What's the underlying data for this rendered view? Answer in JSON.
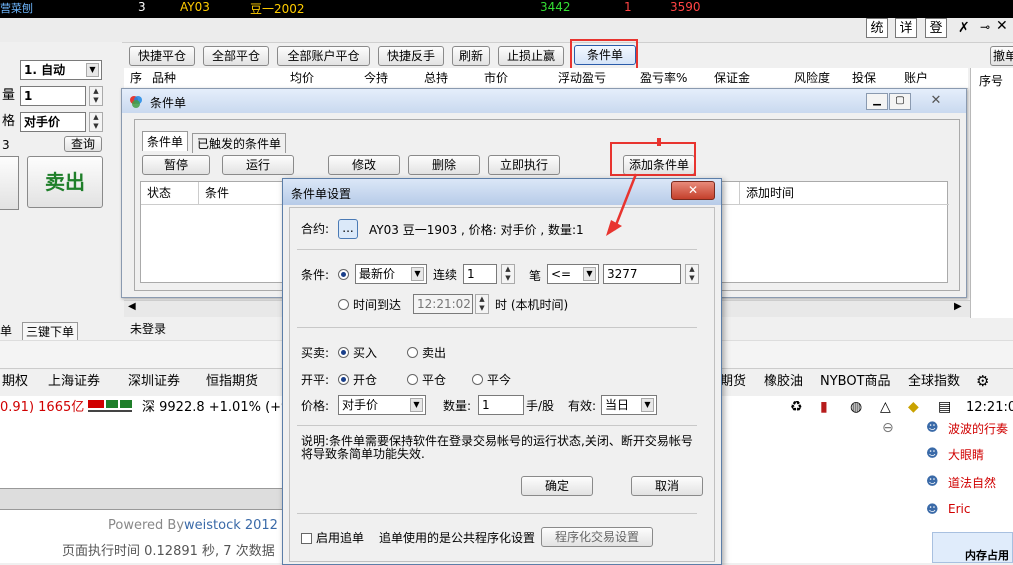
{
  "top": {
    "row_num": "3",
    "row_code": "AY03",
    "row_name": "豆一2002",
    "row_v1": "3442",
    "row_v2": "1",
    "row_v3": "3590",
    "left_label": "营菜刨"
  },
  "top_right_buttons": [
    "统",
    "详",
    "登"
  ],
  "toolbar": {
    "buttons": [
      "快捷平仓",
      "全部平仓",
      "全部账户平仓",
      "快捷反手",
      "刷新",
      "止损止赢",
      "条件单"
    ],
    "cancel_label": "撤单"
  },
  "left_panel": {
    "mode_value": "1. 自动",
    "qty_label": "量",
    "qty_value": "1",
    "price_label": "格",
    "price_value": "对手价",
    "num_label": "3",
    "query_label": "查询",
    "sell_label": "卖出"
  },
  "positions_header": [
    "序",
    "品种",
    "均价",
    "今持",
    "总持",
    "市价",
    "浮动盈亏",
    "盈亏率%",
    "保证金",
    "风险度",
    "投保",
    "账户"
  ],
  "right_col_header": "序号",
  "cond_window": {
    "title": "条件单",
    "tabs": [
      "条件单",
      "已触发的条件单"
    ],
    "buttons": [
      "暂停",
      "运行",
      "修改",
      "删除",
      "立即执行",
      "添加条件单"
    ],
    "columns": [
      "状态",
      "条件",
      "添加时间"
    ]
  },
  "bottom_tabs": [
    "单",
    "三键下单"
  ],
  "not_logged": "未登录",
  "menu": [
    "期权",
    "上海证券",
    "深圳证券",
    "恒指期货",
    "期货",
    "橡胶油",
    "NYBOT商品",
    "全球指数"
  ],
  "status_bar": {
    "left": "0.91) 1665亿",
    "shen": "深 9922.8 +1.01% (+9",
    "time": "12:21:0"
  },
  "footer": {
    "powered": "Powered By",
    "brand": "weistock 2012",
    "exec": "页面执行时间 0.12891 秒, 7 次数据"
  },
  "users": [
    "波波的行奏",
    "大眼睛",
    "道法自然",
    "Eric"
  ],
  "memory_label": "内存占用",
  "dialog": {
    "title": "条件单设置",
    "contract_label": "合约:",
    "contract_btn": "...",
    "contract_info": "AY03 豆一1903 , 价格: 对手价 , 数量:1",
    "condition_label": "条件:",
    "price_type": "最新价",
    "continuous_label": "连续",
    "continuous_value": "1",
    "bi_label": "笔",
    "operator": "<=",
    "threshold": "3277",
    "time_label": "时间到达",
    "time_value": "12:21:02",
    "time_suffix": "时 (本机时间)",
    "buysell_label": "买卖:",
    "buy": "买入",
    "sell": "卖出",
    "openclose_label": "开平:",
    "open": "开仓",
    "close": "平仓",
    "close_today": "平今",
    "price_label": "价格:",
    "price_value": "对手价",
    "qty_label": "数量:",
    "qty_value": "1",
    "qty_unit": "手/股",
    "valid_label": "有效:",
    "valid_value": "当日",
    "note": "说明:条件单需要保持软件在登录交易帐号的运行状态,关闭、断开交易帐号将导致条简单功能失效.",
    "ok": "确定",
    "cancel": "取消",
    "chase_label": "启用追单",
    "chase_note": "追单使用的是公共程序化设置",
    "prog_btn": "程序化交易设置"
  },
  "colors": {
    "highlight": "#e8342f",
    "title_bar": "#c9d9ef",
    "red": "#d00000",
    "green": "#1f7f2a"
  }
}
